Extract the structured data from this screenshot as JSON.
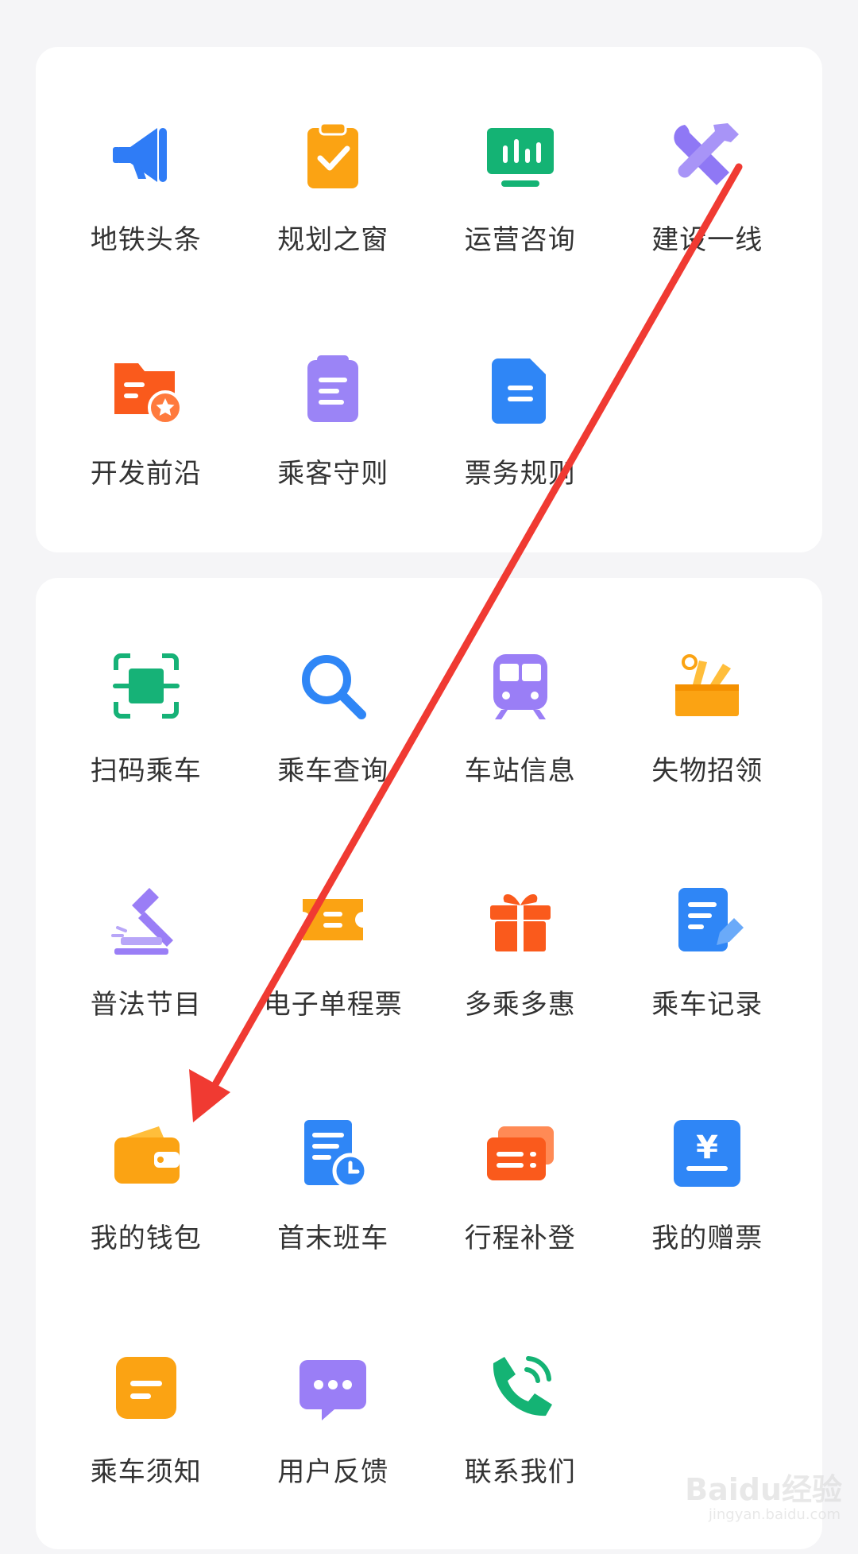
{
  "section_1": {
    "items": [
      {
        "label": "地铁头条",
        "icon": "megaphone-icon",
        "color": "#2f7cf6"
      },
      {
        "label": "规划之窗",
        "icon": "clipboard-check-icon",
        "color": "#fba313"
      },
      {
        "label": "运营咨询",
        "icon": "monitor-chart-icon",
        "color": "#14b374"
      },
      {
        "label": "建设一线",
        "icon": "tools-icon",
        "color": "#8f78f5"
      },
      {
        "label": "开发前沿",
        "icon": "folder-star-icon",
        "color": "#fa5a1c"
      },
      {
        "label": "乘客守则",
        "icon": "notes-icon",
        "color": "#9b84f6"
      },
      {
        "label": "票务规则",
        "icon": "document-icon",
        "color": "#2f86f6"
      }
    ]
  },
  "section_2": {
    "items": [
      {
        "label": "扫码乘车",
        "icon": "scan-icon",
        "color": "#16b277"
      },
      {
        "label": "乘车查询",
        "icon": "search-icon",
        "color": "#2f86f6"
      },
      {
        "label": "车站信息",
        "icon": "train-icon",
        "color": "#9a7ef6"
      },
      {
        "label": "失物招领",
        "icon": "lost-box-icon",
        "color": "#fba313"
      },
      {
        "label": "普法节目",
        "icon": "gavel-icon",
        "color": "#9a7ef6"
      },
      {
        "label": "电子单程票",
        "icon": "ticket-icon",
        "color": "#fba313"
      },
      {
        "label": "多乘多惠",
        "icon": "gift-icon",
        "color": "#fa5a1c"
      },
      {
        "label": "乘车记录",
        "icon": "record-edit-icon",
        "color": "#2f86f6"
      },
      {
        "label": "我的钱包",
        "icon": "wallet-icon",
        "color": "#fba313"
      },
      {
        "label": "首末班车",
        "icon": "schedule-clock-icon",
        "color": "#2f86f6"
      },
      {
        "label": "行程补登",
        "icon": "cards-icon",
        "color": "#fa5a1c"
      },
      {
        "label": "我的赠票",
        "icon": "yen-ticket-icon",
        "color": "#2f86f6"
      },
      {
        "label": "乘车须知",
        "icon": "notice-icon",
        "color": "#fba313"
      },
      {
        "label": "用户反馈",
        "icon": "chat-bubble-icon",
        "color": "#9a7ef6"
      },
      {
        "label": "联系我们",
        "icon": "phone-icon",
        "color": "#14b374"
      }
    ]
  },
  "annotation": {
    "color": "#f03a32"
  },
  "watermark": {
    "logo": "Baidu经验",
    "url": "jingyan.baidu.com"
  }
}
